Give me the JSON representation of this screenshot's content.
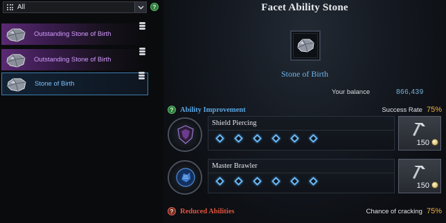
{
  "filter": {
    "selected": "All"
  },
  "stone_list": [
    {
      "name": "Outstanding Stone of Birth",
      "grade": "purple"
    },
    {
      "name": "Outstanding Stone of Birth",
      "grade": "purple"
    },
    {
      "name": "Stone of Birth",
      "grade": "selected"
    }
  ],
  "panel": {
    "title": "Facet Ability Stone",
    "stone_name": "Stone of Birth",
    "balance_label": "Your balance",
    "balance_value": "866,439"
  },
  "ability_improvement": {
    "title": "Ability Improvement",
    "rate_label": "Success Rate",
    "rate_value": "75%",
    "rows": [
      {
        "name": "Shield Piercing",
        "cost": "150",
        "icon": "shield-piercing-icon"
      },
      {
        "name": "Master Brawler",
        "cost": "150",
        "icon": "master-brawler-icon"
      }
    ]
  },
  "reduced_abilities": {
    "title": "Reduced Abilities",
    "rate_label": "Chance of cracking",
    "rate_value": "75%"
  },
  "colors": {
    "accent_blue": "#6fb5ee",
    "purple_grade": "#d39bff",
    "rate_orange": "#f2b34a",
    "reduced_red": "#e0533c",
    "improve_blue": "#5aa8e6"
  }
}
